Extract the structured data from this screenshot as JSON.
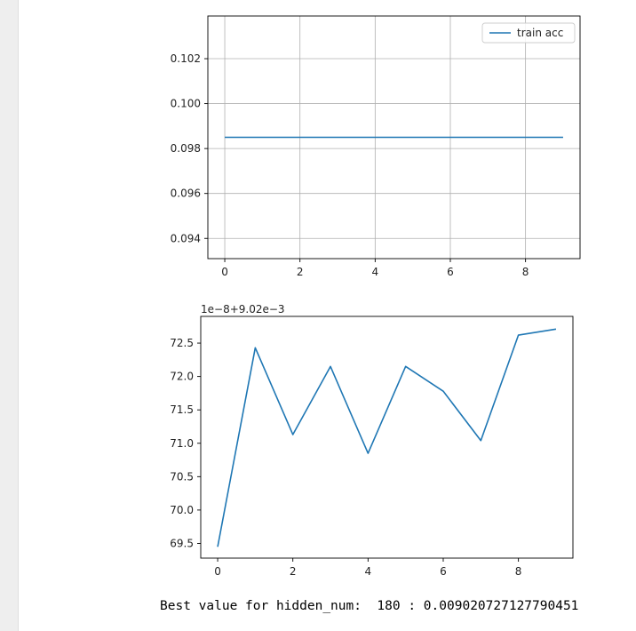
{
  "colors": {
    "line": "#1f77b4",
    "axes": "#000000",
    "grid": "#b0b0b0",
    "text": "#222222",
    "left_strip": "#eeeeee"
  },
  "chart_data": [
    {
      "type": "line",
      "title": "",
      "xlabel": "",
      "ylabel": "",
      "grid": true,
      "legend": "upper right",
      "xlim": [
        -0.45,
        9.45
      ],
      "ylim": [
        0.0931,
        0.1039
      ],
      "xticks": [
        0,
        2,
        4,
        6,
        8
      ],
      "xtick_labels": [
        "0",
        "2",
        "4",
        "6",
        "8"
      ],
      "yticks": [
        0.094,
        0.096,
        0.098,
        0.1,
        0.102
      ],
      "ytick_labels": [
        "0.094",
        "0.096",
        "0.098",
        "0.100",
        "0.102"
      ],
      "series": [
        {
          "name": "train acc",
          "x": [
            0,
            1,
            2,
            3,
            4,
            5,
            6,
            7,
            8,
            9
          ],
          "values": [
            0.0985,
            0.0985,
            0.0985,
            0.0985,
            0.0985,
            0.0985,
            0.0985,
            0.0985,
            0.0985,
            0.0985
          ]
        }
      ]
    },
    {
      "type": "line",
      "title": "",
      "xlabel": "",
      "ylabel": "",
      "grid": false,
      "offset_text": "1e−8+9.02e−3",
      "xlim": [
        -0.45,
        9.45
      ],
      "ylim": [
        69.28,
        72.9
      ],
      "xticks": [
        0,
        2,
        4,
        6,
        8
      ],
      "xtick_labels": [
        "0",
        "2",
        "4",
        "6",
        "8"
      ],
      "yticks": [
        69.5,
        70.0,
        70.5,
        71.0,
        71.5,
        72.0,
        72.5
      ],
      "ytick_labels": [
        "69.5",
        "70.0",
        "70.5",
        "71.0",
        "71.5",
        "72.0",
        "72.5"
      ],
      "series": [
        {
          "x": [
            0,
            1,
            2,
            3,
            4,
            5,
            6,
            7,
            8,
            9
          ],
          "values": [
            69.45,
            72.43,
            71.13,
            72.15,
            70.85,
            72.15,
            71.78,
            71.04,
            72.62,
            72.71
          ]
        }
      ]
    }
  ],
  "output": {
    "text": "Best value for hidden_num:  180 : 0.009020727127790451"
  }
}
